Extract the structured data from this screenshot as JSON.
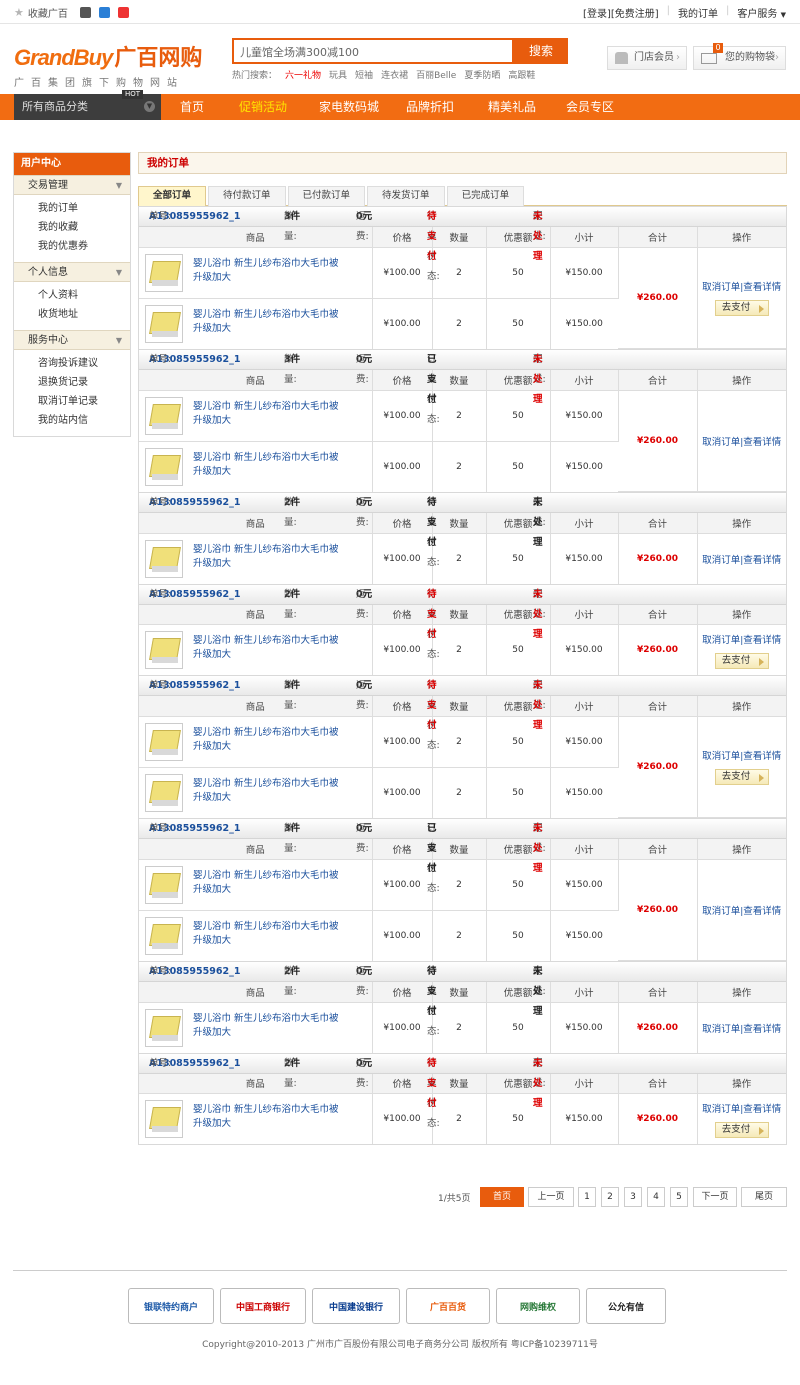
{
  "topbar": {
    "favorite": "收藏广百",
    "login": "[登录]",
    "register": "[免费注册]",
    "my_orders": "我的订单",
    "service": "客户服务"
  },
  "header": {
    "logo_en": "GrandBuy",
    "logo_cn": "广百网购",
    "slogan": "广百集团旗下购物网站",
    "search_placeholder": "儿童馆全场满300减100",
    "search_button": "搜索",
    "hot_label": "热门搜索：",
    "hot_items": [
      "六一礼物",
      "玩具",
      "短袖",
      "连衣裙",
      "百丽Belle",
      "夏季防晒",
      "高跟鞋"
    ],
    "member_btn": "门店会员",
    "cart_btn": "您的购物袋",
    "cart_count": "0"
  },
  "nav": {
    "category": "所有商品分类",
    "items": [
      "首页",
      "促销活动",
      "家电数码城",
      "品牌折扣",
      "精美礼品",
      "会员专区"
    ],
    "hot_badge": "HOT"
  },
  "sidebar": {
    "title": "用户中心",
    "sections": [
      {
        "label": "交易管理",
        "items": [
          "我的订单",
          "我的收藏",
          "我的优惠券"
        ]
      },
      {
        "label": "个人信息",
        "items": [
          "个人资料",
          "收货地址"
        ]
      },
      {
        "label": "服务中心",
        "items": [
          "咨询投诉建议",
          "退换货记录",
          "取消订单记录",
          "我的站内信"
        ]
      }
    ]
  },
  "main": {
    "title": "我的订单",
    "tabs": [
      "全部订单",
      "待付款订单",
      "已付款订单",
      "待发货订单",
      "已完成订单"
    ]
  },
  "labels": {
    "order_no": "单号:",
    "qty": "数量:",
    "freight": "运费:",
    "status": "订单状态:",
    "delivery": "配送:",
    "cols": [
      "商品",
      "价格",
      "数量",
      "优惠额",
      "小计",
      "合计",
      "操作"
    ],
    "cancel": "取消订单",
    "detail": "查看详情",
    "pay": "去支付"
  },
  "orders": [
    {
      "no": "A13085955962_1",
      "qty": "3件",
      "freight": "0元",
      "status": "待支付",
      "status_red": true,
      "delivery": "未处理",
      "delivery_red": true,
      "total": "¥260.00",
      "pay": true,
      "items": [
        {
          "name": "婴儿浴巾 新生儿纱布浴巾大毛巾被升级加大",
          "price": "¥100.00",
          "count": "2",
          "discount": "50",
          "subtotal": "¥150.00"
        },
        {
          "name": "婴儿浴巾 新生儿纱布浴巾大毛巾被升级加大",
          "price": "¥100.00",
          "count": "2",
          "discount": "50",
          "subtotal": "¥150.00"
        }
      ]
    },
    {
      "no": "A13085955962_1",
      "qty": "3件",
      "freight": "0元",
      "status": "已支付",
      "status_red": false,
      "delivery": "未处理",
      "delivery_red": true,
      "total": "¥260.00",
      "pay": false,
      "items": [
        {
          "name": "婴儿浴巾 新生儿纱布浴巾大毛巾被升级加大",
          "price": "¥100.00",
          "count": "2",
          "discount": "50",
          "subtotal": "¥150.00"
        },
        {
          "name": "婴儿浴巾 新生儿纱布浴巾大毛巾被升级加大",
          "price": "¥100.00",
          "count": "2",
          "discount": "50",
          "subtotal": "¥150.00"
        }
      ]
    },
    {
      "no": "A13085955962_1",
      "qty": "2件",
      "freight": "0元",
      "status": "待支付",
      "status_red": false,
      "delivery": "未处理",
      "delivery_red": false,
      "total": "¥260.00",
      "pay": false,
      "items": [
        {
          "name": "婴儿浴巾 新生儿纱布浴巾大毛巾被升级加大",
          "price": "¥100.00",
          "count": "2",
          "discount": "50",
          "subtotal": "¥150.00"
        }
      ]
    },
    {
      "no": "A13085955962_1",
      "qty": "2件",
      "freight": "0元",
      "status": "待支付",
      "status_red": true,
      "delivery": "未处理",
      "delivery_red": true,
      "total": "¥260.00",
      "pay": true,
      "items": [
        {
          "name": "婴儿浴巾 新生儿纱布浴巾大毛巾被升级加大",
          "price": "¥100.00",
          "count": "2",
          "discount": "50",
          "subtotal": "¥150.00"
        }
      ]
    },
    {
      "no": "A13085955962_1",
      "qty": "3件",
      "freight": "0元",
      "status": "待支付",
      "status_red": true,
      "delivery": "未处理",
      "delivery_red": true,
      "total": "¥260.00",
      "pay": true,
      "items": [
        {
          "name": "婴儿浴巾 新生儿纱布浴巾大毛巾被升级加大",
          "price": "¥100.00",
          "count": "2",
          "discount": "50",
          "subtotal": "¥150.00"
        },
        {
          "name": "婴儿浴巾 新生儿纱布浴巾大毛巾被升级加大",
          "price": "¥100.00",
          "count": "2",
          "discount": "50",
          "subtotal": "¥150.00"
        }
      ]
    },
    {
      "no": "A13085955962_1",
      "qty": "3件",
      "freight": "0元",
      "status": "已支付",
      "status_red": false,
      "delivery": "未处理",
      "delivery_red": true,
      "total": "¥260.00",
      "pay": false,
      "items": [
        {
          "name": "婴儿浴巾 新生儿纱布浴巾大毛巾被升级加大",
          "price": "¥100.00",
          "count": "2",
          "discount": "50",
          "subtotal": "¥150.00"
        },
        {
          "name": "婴儿浴巾 新生儿纱布浴巾大毛巾被升级加大",
          "price": "¥100.00",
          "count": "2",
          "discount": "50",
          "subtotal": "¥150.00"
        }
      ]
    },
    {
      "no": "A13085955962_1",
      "qty": "2件",
      "freight": "0元",
      "status": "待支付",
      "status_red": false,
      "delivery": "未处理",
      "delivery_red": false,
      "total": "¥260.00",
      "pay": false,
      "items": [
        {
          "name": "婴儿浴巾 新生儿纱布浴巾大毛巾被升级加大",
          "price": "¥100.00",
          "count": "2",
          "discount": "50",
          "subtotal": "¥150.00"
        }
      ]
    },
    {
      "no": "A13085955962_1",
      "qty": "2件",
      "freight": "0元",
      "status": "待支付",
      "status_red": true,
      "delivery": "未处理",
      "delivery_red": true,
      "total": "¥260.00",
      "pay": true,
      "items": [
        {
          "name": "婴儿浴巾 新生儿纱布浴巾大毛巾被升级加大",
          "price": "¥100.00",
          "count": "2",
          "discount": "50",
          "subtotal": "¥150.00"
        }
      ]
    }
  ],
  "pager": {
    "info": "1/共5页",
    "first": "首页",
    "prev": "上一页",
    "pages": [
      "1",
      "2",
      "3",
      "4",
      "5"
    ],
    "next": "下一页",
    "last": "尾页"
  },
  "footer": {
    "badges": [
      "银联特约商户",
      "中国工商银行",
      "中国建设银行",
      "广百百货",
      "网购维权",
      "公允有信"
    ],
    "copyright": "Copyright@2010-2013 广州市广百股份有限公司电子商务分公司 版权所有 粤ICP备10239711号"
  },
  "colors": {
    "brand": "#e85c0d",
    "nav": "#f26c12",
    "link": "#1a4f9c",
    "alert": "#dd0000"
  }
}
